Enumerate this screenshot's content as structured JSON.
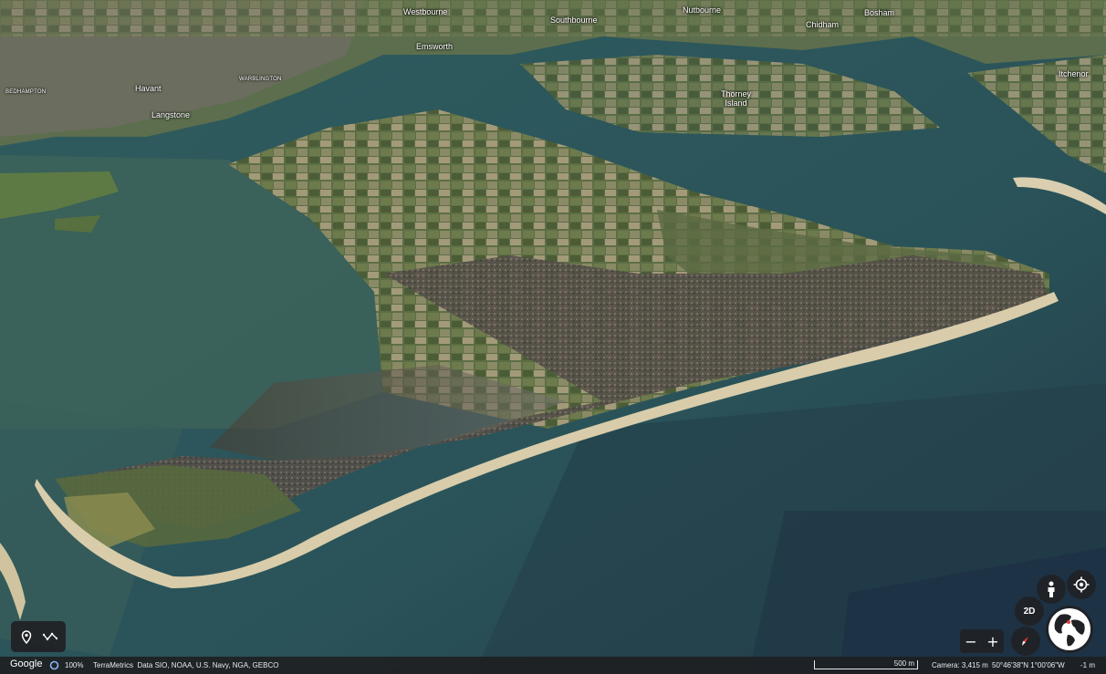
{
  "places": [
    {
      "name": "Westbourne",
      "size": "normal"
    },
    {
      "name": "Southbourne",
      "size": "normal"
    },
    {
      "name": "Nutbourne",
      "size": "normal"
    },
    {
      "name": "Chidham",
      "size": "normal"
    },
    {
      "name": "Bosham",
      "size": "normal"
    },
    {
      "name": "Emsworth",
      "size": "normal"
    },
    {
      "name": "Itchenor",
      "size": "normal"
    },
    {
      "name": "Thorney\nIsland",
      "size": "normal"
    },
    {
      "name": "Havant",
      "size": "normal"
    },
    {
      "name": "Langstone",
      "size": "normal"
    },
    {
      "name": "BEDHAMPTON",
      "size": "small"
    },
    {
      "name": "WARBLINGTON",
      "size": "small"
    }
  ],
  "controls": {
    "view_2d_label": "2D",
    "zoom_out": "−",
    "zoom_in": "+"
  },
  "icons": {
    "pegman": "pegman-icon",
    "my_location": "my-location-icon",
    "compass": "compass-icon",
    "globe": "globe-icon",
    "place_pin": "place-pin-icon",
    "measure": "measure-icon"
  },
  "status_bar": {
    "logo": "Google",
    "progress": "100%",
    "attribution": "TerraMetrics  Data SIO, NOAA, U.S. Navy, NGA, GEBCO",
    "scale": "500 m",
    "camera": "Camera: 3,415 m",
    "coordinates": "50°46'38\"N 1°00'06\"W",
    "elevation": "-1 m"
  },
  "colors": {
    "sea": "#2f5a5e",
    "deep_sea": "#22404a",
    "land_green": "#4f6a3a",
    "urban": "#5a5a52",
    "sand": "#d9cfb0",
    "ui_dark": "#202124"
  }
}
